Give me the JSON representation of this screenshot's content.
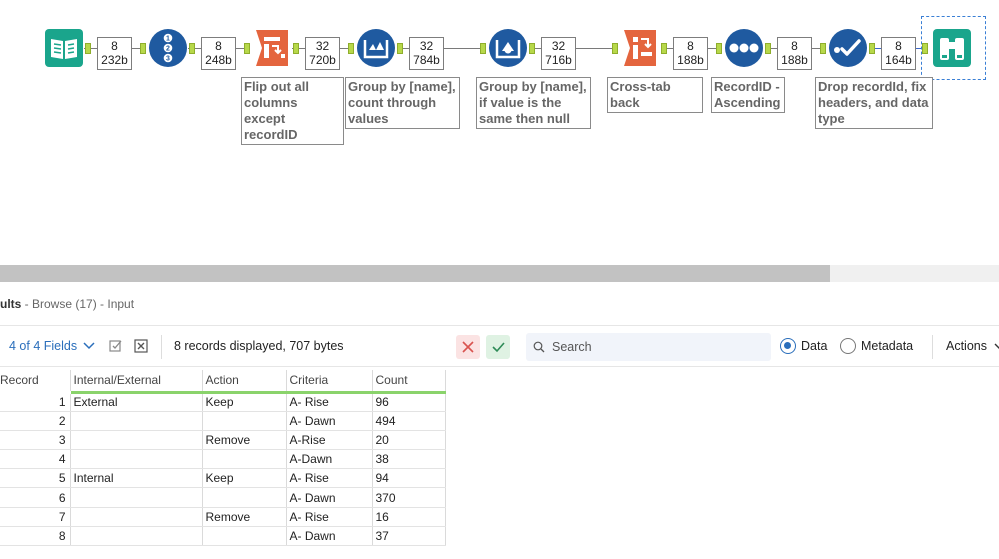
{
  "canvas": {
    "badges": [
      {
        "records": "8",
        "bytes": "232b"
      },
      {
        "records": "8",
        "bytes": "248b"
      },
      {
        "records": "32",
        "bytes": "720b"
      },
      {
        "records": "32",
        "bytes": "784b"
      },
      {
        "records": "32",
        "bytes": "716b"
      },
      {
        "records": "8",
        "bytes": "188b"
      },
      {
        "records": "8",
        "bytes": "188b"
      },
      {
        "records": "8",
        "bytes": "164b"
      }
    ],
    "annotations": [
      "Flip out all columns except recordID",
      "Group by [name], count through values",
      "Group by [name], if value is the same then null",
      "Cross-tab back",
      "RecordID - Ascending",
      "Drop recordId, fix headers, and data type"
    ],
    "tools": [
      "input-book-icon",
      "record-id-icon",
      "transpose-icon",
      "multi-row-formula-icon",
      "multi-row-formula-icon",
      "cross-tab-icon",
      "sort-icon",
      "select-icon",
      "browse-binoculars-icon"
    ],
    "colors": {
      "input": "#1aa58c",
      "blue": "#1f5aa0",
      "orange": "#e4653e",
      "browse": "#1aa58c",
      "anchor": "#b7d84a"
    }
  },
  "results": {
    "header_prefix": "ults",
    "header_rest": " - Browse (17) - Input",
    "fields_label": "4 of 4 Fields",
    "records_text": "8 records displayed, 707 bytes",
    "search_placeholder": "Search",
    "radio_data": "Data",
    "radio_metadata": "Metadata",
    "actions_label": "Actions"
  },
  "grid": {
    "columns": [
      "Record",
      "Internal/External",
      "Action",
      "Criteria",
      "Count"
    ],
    "rows": [
      [
        "1",
        "External",
        "Keep",
        "A- Rise",
        "96"
      ],
      [
        "2",
        "",
        "",
        "A- Dawn",
        "494"
      ],
      [
        "3",
        "",
        "Remove",
        "A-Rise",
        "20"
      ],
      [
        "4",
        "",
        "",
        "A-Dawn",
        "38"
      ],
      [
        "5",
        "Internal",
        "Keep",
        "A- Rise",
        "94"
      ],
      [
        "6",
        "",
        "",
        "A- Dawn",
        "370"
      ],
      [
        "7",
        "",
        "Remove",
        "A- Rise",
        "16"
      ],
      [
        "8",
        "",
        "",
        "A- Dawn",
        "37"
      ]
    ]
  }
}
